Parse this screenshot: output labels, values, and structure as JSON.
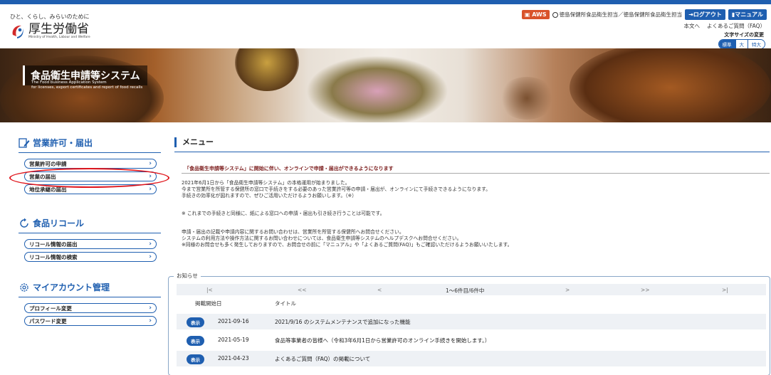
{
  "header": {
    "tagline": "ひと、くらし、みらいのために",
    "logo_jp": "厚生労働省",
    "logo_en": "Ministry of Health, Labour and Welfare",
    "aws_label": "AWS",
    "user_text": "徳島保健所食品衛生担当／徳島保健所食品衛生担当",
    "logout_label": "ログアウト",
    "manual_label": "マニュアル",
    "link_main": "本文へ",
    "link_faq": "よくあるご質問（FAQ）",
    "fontsize_label": "文字サイズの変更",
    "fontsize_options": [
      "標準",
      "大",
      "特大"
    ]
  },
  "banner": {
    "title": "食品衛生申請等システム",
    "subtitle_line1": "The Food business Application System",
    "subtitle_line2": "for licenses, export certificates and report of food recalls"
  },
  "sidebar": {
    "sections": [
      {
        "title": "営業許可・届出",
        "items": [
          "営業許可の申請",
          "営業の届出",
          "地位承継の届出"
        ]
      },
      {
        "title": "食品リコール",
        "items": [
          "リコール情報の届出",
          "リコール情報の検索"
        ]
      },
      {
        "title": "マイアカウント管理",
        "items": [
          "プロフィール変更",
          "パスワード変更"
        ]
      }
    ]
  },
  "main": {
    "menu_title": "メニュー",
    "notice_heading": "「食品衛生申請等システム」に開始に伴い、オンラインで申請・届出ができるようになります",
    "paragraphs": [
      "2021年6月1日から「食品衛生申請等システム」の本格運用が始まりました。",
      "今まで営業所を所管する保健所の窓口で手続きをする必要のあった営業許可等の申請・届出が、オンラインにて手続きできるようになります。",
      "手続きの効率化が図れますので、ぜひご活用いただけるようお願いします。（※）",
      "※ これまでの手続きと同様に、紙による窓口への申請・届出も引き続き行うことは可能です。",
      "申請・届出の記載や申請内容に関するお問い合わせは、営業所を所管する保健所へお問合せください。",
      "システムの利用方法や操作方法に関するお問い合わせについては、食品衛生申請等システムのヘルプデスクへお問合せください。",
      "※同様のお問合せも多く発生しておりますので、お問合せの前に「マニュアル」や「よくあるご質問(FAQ)」もご確認いただけるようお願いいたします。"
    ]
  },
  "news": {
    "legend": "お知らせ",
    "pager": {
      "first": "|<",
      "prev2": "<<",
      "prev": "<",
      "status": "1～6件目/6件中",
      "next": ">",
      "next2": ">>",
      "last": ">|"
    },
    "col_date": "掲載開始日",
    "col_title": "タイトル",
    "view_label": "表示",
    "rows": [
      {
        "date": "2021-09-16",
        "title": "2021/9/16 のシステムメンテナンスで追加になった機能"
      },
      {
        "date": "2021-05-19",
        "title": "食品等事業者の皆様へ（令和3年6月1日から営業許可のオンライン手続きを開始します。）"
      },
      {
        "date": "2021-04-23",
        "title": "よくあるご質問（FAQ）の掲載について"
      }
    ]
  },
  "colors": {
    "accent": "#1f5fb0",
    "aws": "#d9532a",
    "highlight": "#e0161c",
    "notice": "#7a1a1a"
  }
}
